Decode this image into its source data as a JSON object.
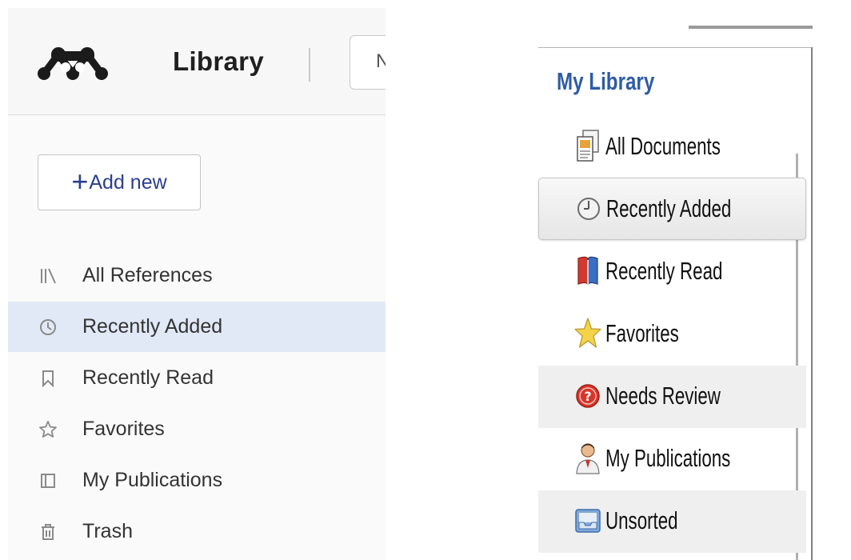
{
  "web_app": {
    "header": {
      "title": "Library",
      "search_partial_text": "N"
    },
    "add_new_label": "Add new",
    "nav_items": [
      {
        "label": "All References",
        "icon": "books-icon",
        "selected": false
      },
      {
        "label": "Recently Added",
        "icon": "clock-icon",
        "selected": true
      },
      {
        "label": "Recently Read",
        "icon": "bookmark-icon",
        "selected": false
      },
      {
        "label": "Favorites",
        "icon": "star-icon",
        "selected": false
      },
      {
        "label": "My Publications",
        "icon": "publications-icon",
        "selected": false
      },
      {
        "label": "Trash",
        "icon": "trash-icon",
        "selected": false
      }
    ],
    "colors": {
      "selected_bg": "#e1e9f7",
      "accent": "#2a3f8f"
    }
  },
  "desktop_app": {
    "title": "My Library",
    "items": [
      {
        "label": "All Documents",
        "icon": "documents-icon"
      },
      {
        "label": "Recently Added",
        "icon": "clock-icon",
        "selected": true
      },
      {
        "label": "Recently Read",
        "icon": "book-icon"
      },
      {
        "label": "Favorites",
        "icon": "star-icon"
      },
      {
        "label": "Needs Review",
        "icon": "question-icon"
      },
      {
        "label": "My Publications",
        "icon": "person-icon"
      },
      {
        "label": "Unsorted",
        "icon": "tray-icon"
      }
    ],
    "colors": {
      "title": "#2e5ba7"
    }
  }
}
